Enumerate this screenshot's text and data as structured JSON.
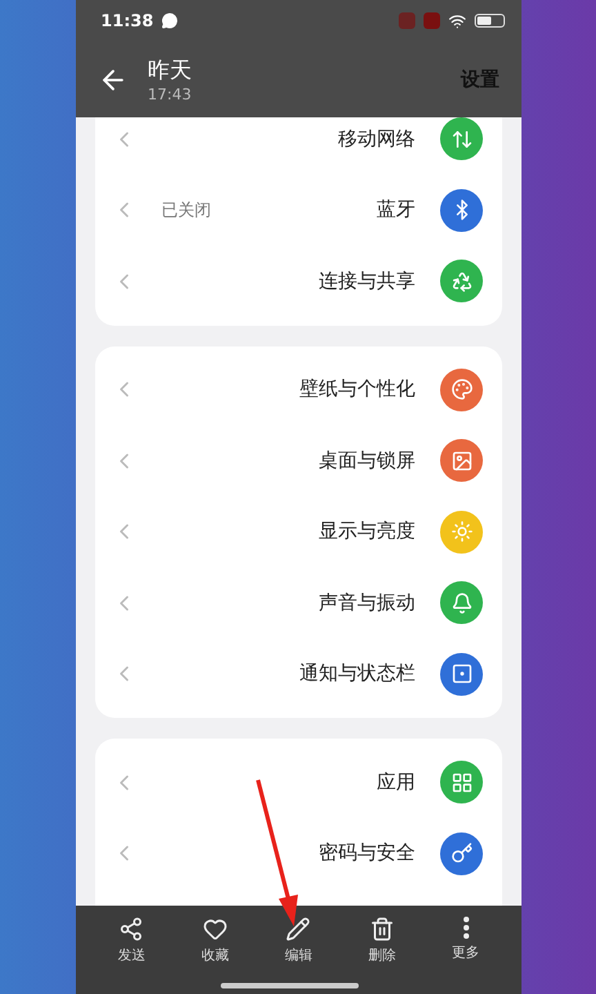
{
  "status_bar": {
    "time": "11:38"
  },
  "header": {
    "title": "昨天",
    "subtitle": "17:43",
    "action": "设置"
  },
  "groups": [
    {
      "items": [
        {
          "label": "移动网络",
          "kind": "network",
          "color": "#2fb44f"
        },
        {
          "label": "蓝牙",
          "value": "已关闭",
          "kind": "bluetooth",
          "color": "#2f6fd8"
        },
        {
          "label": "连接与共享",
          "kind": "share",
          "color": "#2fb44f"
        }
      ]
    },
    {
      "items": [
        {
          "label": "壁纸与个性化",
          "kind": "palette",
          "color": "#e8683f"
        },
        {
          "label": "桌面与锁屏",
          "kind": "image",
          "color": "#e8683f"
        },
        {
          "label": "显示与亮度",
          "kind": "sun",
          "color": "#f2c21b"
        },
        {
          "label": "声音与振动",
          "kind": "bell",
          "color": "#2fb44f"
        },
        {
          "label": "通知与状态栏",
          "kind": "notice",
          "color": "#2f6fd8"
        }
      ]
    },
    {
      "items": [
        {
          "label": "应用",
          "kind": "grid",
          "color": "#2fb44f"
        },
        {
          "label": "密码与安全",
          "kind": "key",
          "color": "#2f6fd8"
        }
      ]
    }
  ],
  "toolbar": [
    {
      "label": "发送",
      "kind": "send"
    },
    {
      "label": "收藏",
      "kind": "favorite"
    },
    {
      "label": "编辑",
      "kind": "edit"
    },
    {
      "label": "删除",
      "kind": "delete"
    },
    {
      "label": "更多",
      "kind": "more"
    }
  ]
}
